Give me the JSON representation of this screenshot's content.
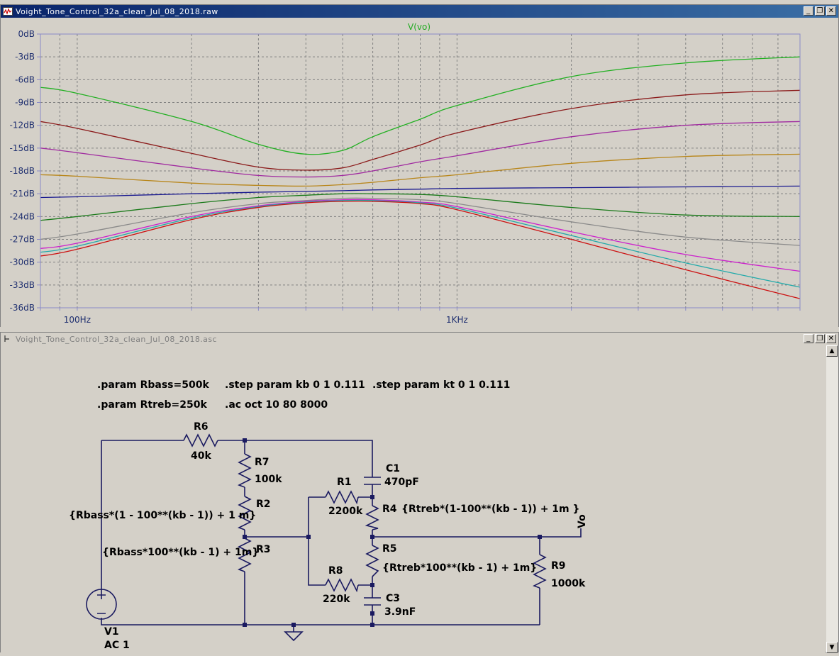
{
  "plot_window": {
    "title": "Voight_Tone_Control_32a_clean_Jul_08_2018.raw",
    "trace_label": "V(vo)"
  },
  "schematic_window": {
    "title": "Voight_Tone_Control_32a_clean_Jul_08_2018.asc"
  },
  "window_buttons": {
    "minimize": "_",
    "restore": "❐",
    "close": "✕"
  },
  "colors": {
    "grid": "#808080",
    "axis": "#8a8ac8",
    "wire": "#1a1a60",
    "label": "#22aa22"
  },
  "chart_data": {
    "type": "line",
    "xlabel": "",
    "ylabel": "",
    "x_scale": "log",
    "x_range": [
      80,
      8000
    ],
    "ylim": [
      -36,
      0
    ],
    "y_ticks": [
      "0dB",
      "-3dB",
      "-6dB",
      "-9dB",
      "-12dB",
      "-15dB",
      "-18dB",
      "-21dB",
      "-24dB",
      "-27dB",
      "-30dB",
      "-33dB",
      "-36dB"
    ],
    "x_ticks": [
      "100Hz",
      "1KHz"
    ],
    "grid": true,
    "legend": "V(vo)",
    "x": [
      80,
      100,
      200,
      300,
      400,
      500,
      600,
      800,
      1000,
      2000,
      4000,
      8000
    ],
    "series": [
      {
        "color": "#22b022",
        "values": [
          -7.0,
          -7.8,
          -11.5,
          -14.5,
          -15.8,
          -15.3,
          -13.5,
          -11.2,
          -9.4,
          -5.6,
          -3.8,
          -3.0
        ]
      },
      {
        "color": "#8b1a1a",
        "values": [
          -11.5,
          -12.4,
          -15.7,
          -17.5,
          -17.9,
          -17.6,
          -16.5,
          -14.6,
          -13.0,
          -9.8,
          -8.0,
          -7.4
        ]
      },
      {
        "color": "#a02aa0",
        "values": [
          -15.0,
          -15.6,
          -17.6,
          -18.6,
          -18.8,
          -18.6,
          -18.0,
          -16.8,
          -16.0,
          -13.5,
          -12.0,
          -11.5
        ]
      },
      {
        "color": "#b8861a",
        "values": [
          -18.5,
          -18.7,
          -19.6,
          -19.9,
          -20.0,
          -19.8,
          -19.5,
          -18.9,
          -18.5,
          -17.0,
          -16.1,
          -15.8
        ]
      },
      {
        "color": "#1a1a90",
        "values": [
          -21.5,
          -21.4,
          -21.0,
          -20.8,
          -20.7,
          -20.6,
          -20.5,
          -20.4,
          -20.3,
          -20.2,
          -20.1,
          -20.0
        ]
      },
      {
        "color": "#1a7a1a",
        "values": [
          -24.5,
          -24.0,
          -22.3,
          -21.5,
          -21.2,
          -21.0,
          -21.0,
          -21.1,
          -21.4,
          -22.8,
          -23.8,
          -24.0
        ]
      },
      {
        "color": "#8a8a8a",
        "values": [
          -27.0,
          -26.3,
          -23.5,
          -22.3,
          -21.9,
          -21.6,
          -21.6,
          -21.8,
          -22.3,
          -24.7,
          -26.7,
          -27.8
        ]
      },
      {
        "color": "#cc22cc",
        "values": [
          -28.2,
          -27.5,
          -24.0,
          -22.6,
          -22.0,
          -21.8,
          -21.8,
          -22.1,
          -22.7,
          -26.0,
          -29.0,
          -31.2
        ]
      },
      {
        "color": "#22aaaa",
        "values": [
          -28.7,
          -27.9,
          -24.2,
          -22.7,
          -22.1,
          -21.9,
          -21.9,
          -22.2,
          -22.9,
          -26.5,
          -30.1,
          -33.3
        ]
      },
      {
        "color": "#cc1111",
        "values": [
          -29.2,
          -28.3,
          -24.4,
          -22.8,
          -22.2,
          -22.0,
          -22.0,
          -22.3,
          -23.1,
          -27.0,
          -31.0,
          -34.8
        ]
      }
    ]
  },
  "schematic": {
    "directives": {
      "rbass": ".param Rbass=500k",
      "rtreb": ".param Rtreb=250k",
      "step_kb": ".step param kb 0 1 0.111",
      "step_kt": ".step param kt 0 1 0.111",
      "ac": ".ac oct 10 80 8000"
    },
    "components": {
      "r6_name": "R6",
      "r6_value": "40k",
      "r7_name": "R7",
      "r7_value": "100k",
      "r2_name": "R2",
      "r2_value": "{Rbass*(1 - 100**(kb - 1)) + 1 m}",
      "r3_name": "R3",
      "r3_value": "{Rbass*100**(kb - 1) + 1m}",
      "r1_name": "R1",
      "r1_value": "2200k",
      "r4_name": "R4",
      "r4_value": "{Rtreb*(1-100**(kb - 1)) + 1m }",
      "r5_name": "R5",
      "r5_value": "{Rtreb*100**(kb - 1) + 1m}",
      "r8_name": "R8",
      "r8_value": "220k",
      "r9_name": "R9",
      "r9_value": "1000k",
      "c1_name": "C1",
      "c1_value": "470pF",
      "c3_name": "C3",
      "c3_value": "3.9nF",
      "v1_name": "V1",
      "v1_value": "AC 1",
      "vo_label": "Vo"
    }
  }
}
